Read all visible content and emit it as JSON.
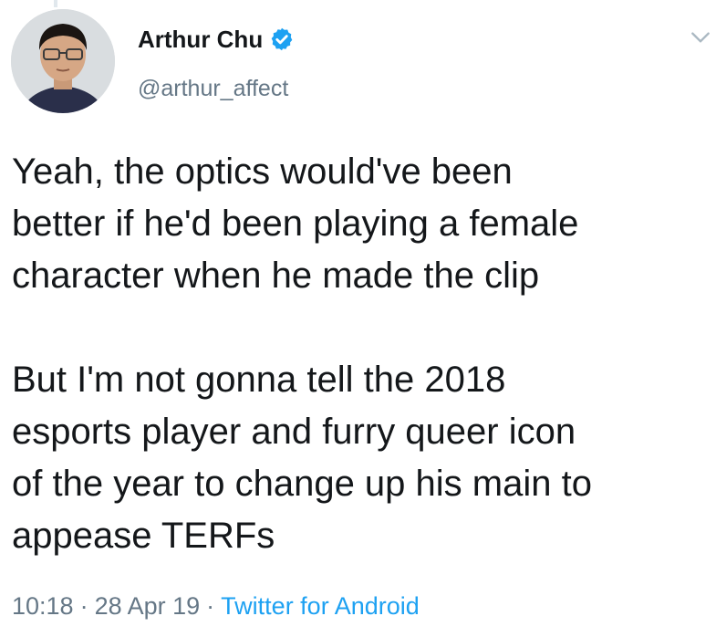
{
  "author": {
    "display_name": "Arthur Chu",
    "handle": "@arthur_affect",
    "verified": true
  },
  "tweet": {
    "lines_paragraph_1": [
      "Yeah, the optics would've been",
      "better if he'd been playing a female",
      "character when he made the clip"
    ],
    "lines_paragraph_2": [
      "But I'm not gonna tell the 2018",
      "esports player and furry queer icon",
      "of the year to change up his main to",
      "appease TERFs"
    ]
  },
  "meta": {
    "time": "10:18",
    "separator": "·",
    "date": "28 Apr 19",
    "source": "Twitter for Android"
  },
  "icons": {
    "verified": "verified-badge-icon",
    "menu": "chevron-down-icon"
  },
  "colors": {
    "verified_blue": "#1da1f2",
    "link_blue": "#1da1f2",
    "secondary_text": "#657786",
    "primary_text": "#14171a"
  }
}
